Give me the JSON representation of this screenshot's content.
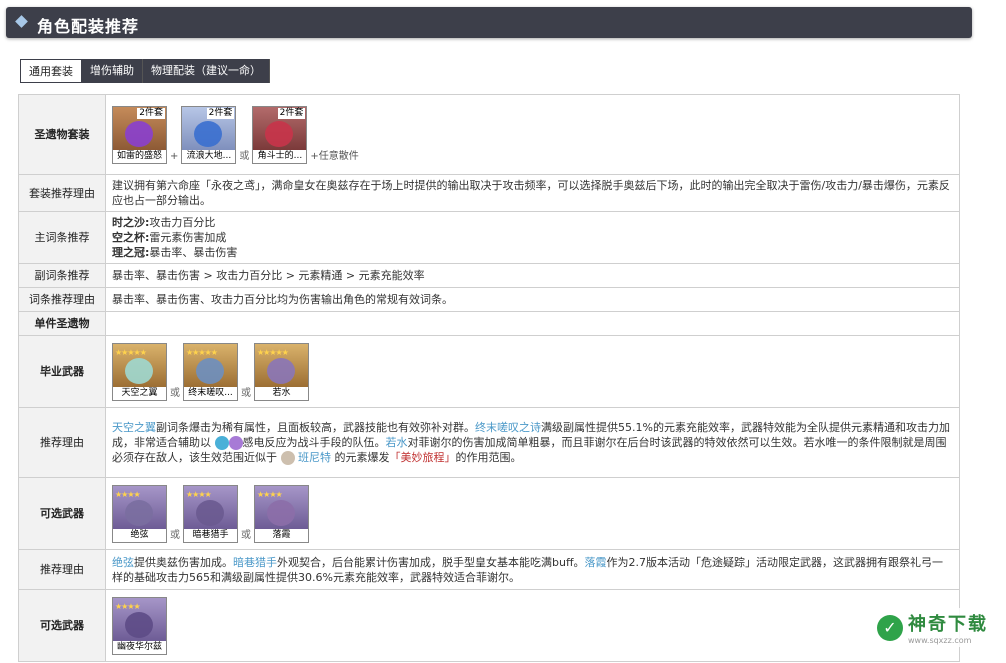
{
  "header": {
    "title": "角色配装推荐"
  },
  "tabs": [
    "通用套装",
    "增伤辅助",
    "物理配装（建议一命）"
  ],
  "artifact_set": {
    "label": "圣遗物套装",
    "items": [
      {
        "badge": "2件套",
        "name": "如雷的盛怒"
      },
      {
        "badge": "2件套",
        "name": "流浪大地..."
      },
      {
        "badge": "2件套",
        "name": "角斗士的..."
      }
    ],
    "plus": "+",
    "or": "或",
    "suffix": "+任意散件"
  },
  "set_reason": {
    "label": "套装推荐理由",
    "text": "建议拥有第六命座「永夜之鸢」，满命皇女在奥兹存在于场上时提供的输出取决于攻击频率，可以选择脱手奥兹后下场，此时的输出完全取决于雷伤/攻击力/暴击爆伤，元素反应也占一部分输出。"
  },
  "main_stats": {
    "label": "主词条推荐",
    "rows": [
      {
        "k": "时之沙:",
        "v": "攻击力百分比"
      },
      {
        "k": "空之杯:",
        "v": "雷元素伤害加成"
      },
      {
        "k": "理之冠:",
        "v": "暴击率、暴击伤害"
      }
    ]
  },
  "sub_stats": {
    "label": "副词条推荐",
    "text": "暴击率、暴击伤害 > 攻击力百分比 > 元素精通 > 元素充能效率"
  },
  "stat_reason": {
    "label": "词条推荐理由",
    "text": "暴击率、暴击伤害、攻击力百分比均为伤害输出角色的常规有效词条。"
  },
  "single": {
    "label": "单件圣遗物"
  },
  "bis_weapon": {
    "label": "毕业武器",
    "items": [
      {
        "stars": "★★★★★",
        "name": "天空之翼"
      },
      {
        "stars": "★★★★★",
        "name": "终末嗟叹..."
      },
      {
        "stars": "★★★★★",
        "name": "若水"
      }
    ],
    "or": "或"
  },
  "bis_reason": {
    "label": "推荐理由",
    "p1_link": "天空之翼",
    "p1": "副词条爆击为稀有属性，且面板较高，武器技能也有效弥补对群。",
    "p2_link": "终末嗟叹之诗",
    "p2": "满级副属性提供55.1%的元素充能效率，武器特效能为全队提供元素精通和攻击力加成，非常适合辅助以",
    "p3": "感电反应为战斗手段的队伍。",
    "p4_link": "若水",
    "p4": "对菲谢尔的伤害加成简单粗暴，而且菲谢尔在后台时该武器的特效依然可以生效。若水唯一的条件限制就是周围必须存在敌人，该生效范围近似于",
    "p5_link": "班尼特",
    "p6": "的元素爆发",
    "p7_link": "「美妙旅程」",
    "p8": "的作用范围。"
  },
  "alt_weapon": {
    "label": "可选武器",
    "items": [
      {
        "stars": "★★★★",
        "name": "绝弦"
      },
      {
        "stars": "★★★★",
        "name": "暗巷猎手"
      },
      {
        "stars": "★★★★",
        "name": "落霞"
      }
    ],
    "or": "或"
  },
  "alt_reason": {
    "label": "推荐理由",
    "l1_link": "绝弦",
    "l1": "提供奥兹伤害加成。",
    "l2_link": "暗巷猎手",
    "l2": "外观契合，后台能累计伤害加成，脱手型皇女基本能吃满buff。",
    "l3_link": "落霞",
    "l3": "作为2.7版本活动「危途疑踪」活动限定武器，这武器拥有跟祭礼弓一样的基础攻击力565和满级副属性提供30.6%元素充能效率，武器特效适合菲谢尔。"
  },
  "alt_weapon2": {
    "label": "可选武器",
    "items": [
      {
        "stars": "★★★★",
        "name": "幽夜华尔兹"
      }
    ]
  },
  "watermark": {
    "name": "神奇下载",
    "url": "www.sqxzz.com"
  }
}
